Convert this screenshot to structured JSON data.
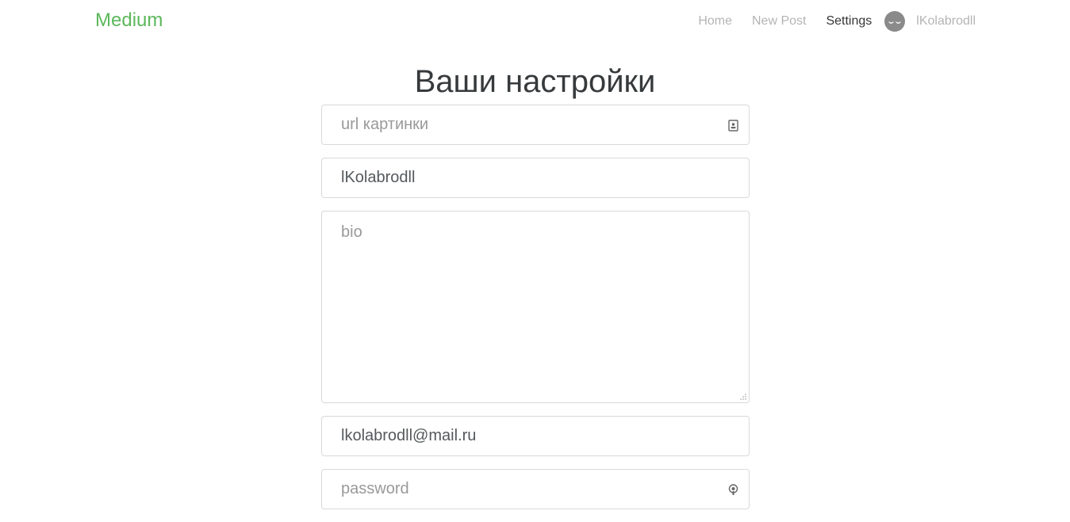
{
  "navbar": {
    "brand": "Medium",
    "links": {
      "home": "Home",
      "new_post": "New Post",
      "settings": "Settings",
      "username": "lKolabrodll"
    },
    "active": "settings"
  },
  "page": {
    "title": "Ваши настройки"
  },
  "form": {
    "image_url": {
      "value": "",
      "placeholder": "url картинки",
      "icon": "contact-card-icon"
    },
    "username": {
      "value": "lKolabrodll",
      "placeholder": ""
    },
    "bio": {
      "value": "",
      "placeholder": "bio"
    },
    "email": {
      "value": "lkolabrodll@mail.ru",
      "placeholder": ""
    },
    "password": {
      "value": "",
      "placeholder": "password",
      "icon": "password-key-icon"
    }
  },
  "colors": {
    "brand": "#5cb85c",
    "nav_inactive": "rgba(0,0,0,0.3)",
    "nav_active": "rgba(0,0,0,0.8)",
    "placeholder": "#999999"
  }
}
